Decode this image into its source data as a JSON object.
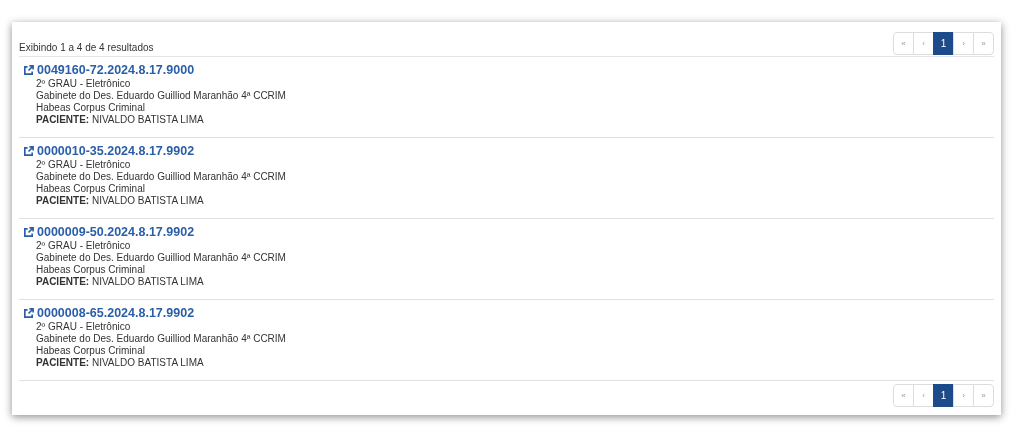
{
  "summary": "Exibindo 1 a 4 de 4 resultados",
  "pager_top": [
    {
      "label": "«",
      "selected": false
    },
    {
      "label": "‹",
      "selected": false
    },
    {
      "label": "1",
      "selected": true
    },
    {
      "label": "›",
      "selected": false
    },
    {
      "label": "»",
      "selected": false
    }
  ],
  "results": [
    {
      "number": "0049160-72.2024.8.17.9000",
      "instance": "2º GRAU - Eletrônico",
      "office": "Gabinete do Des. Eduardo Guilliod Maranhão 4ª CCRIM",
      "class": "Habeas Corpus Criminal",
      "party": "**PACIENTE:** NIVALDO BATISTA LIMA"
    },
    {
      "number": "0000010-35.2024.8.17.9902",
      "instance": "2º GRAU - Eletrônico",
      "office": "Gabinete do Des. Eduardo Guilliod Maranhão 4ª CCRIM",
      "class": "Habeas Corpus Criminal",
      "party": "**PACIENTE:** NIVALDO BATISTA LIMA"
    },
    {
      "number": "0000009-50.2024.8.17.9902",
      "instance": "2º GRAU - Eletrônico",
      "office": "Gabinete do Des. Eduardo Guilliod Maranhão 4ª CCRIM",
      "class": "Habeas Corpus Criminal",
      "party": "**PACIENTE:** NIVALDO BATISTA LIMA"
    },
    {
      "number": "0000008-65.2024.8.17.9902",
      "instance": "2º GRAU - Eletrônico",
      "office": "Gabinete do Des. Eduardo Guilliod Maranhão 4ª CCRIM",
      "class": "Habeas Corpus Criminal",
      "party": "**PACIENTE:** NIVALDO BATISTA LIMA"
    }
  ],
  "pager_bottom": [
    {
      "label": "«",
      "selected": false
    },
    {
      "label": "‹",
      "selected": false
    },
    {
      "label": "1",
      "selected": true
    },
    {
      "label": "›",
      "selected": false
    },
    {
      "label": "»",
      "selected": false
    }
  ]
}
